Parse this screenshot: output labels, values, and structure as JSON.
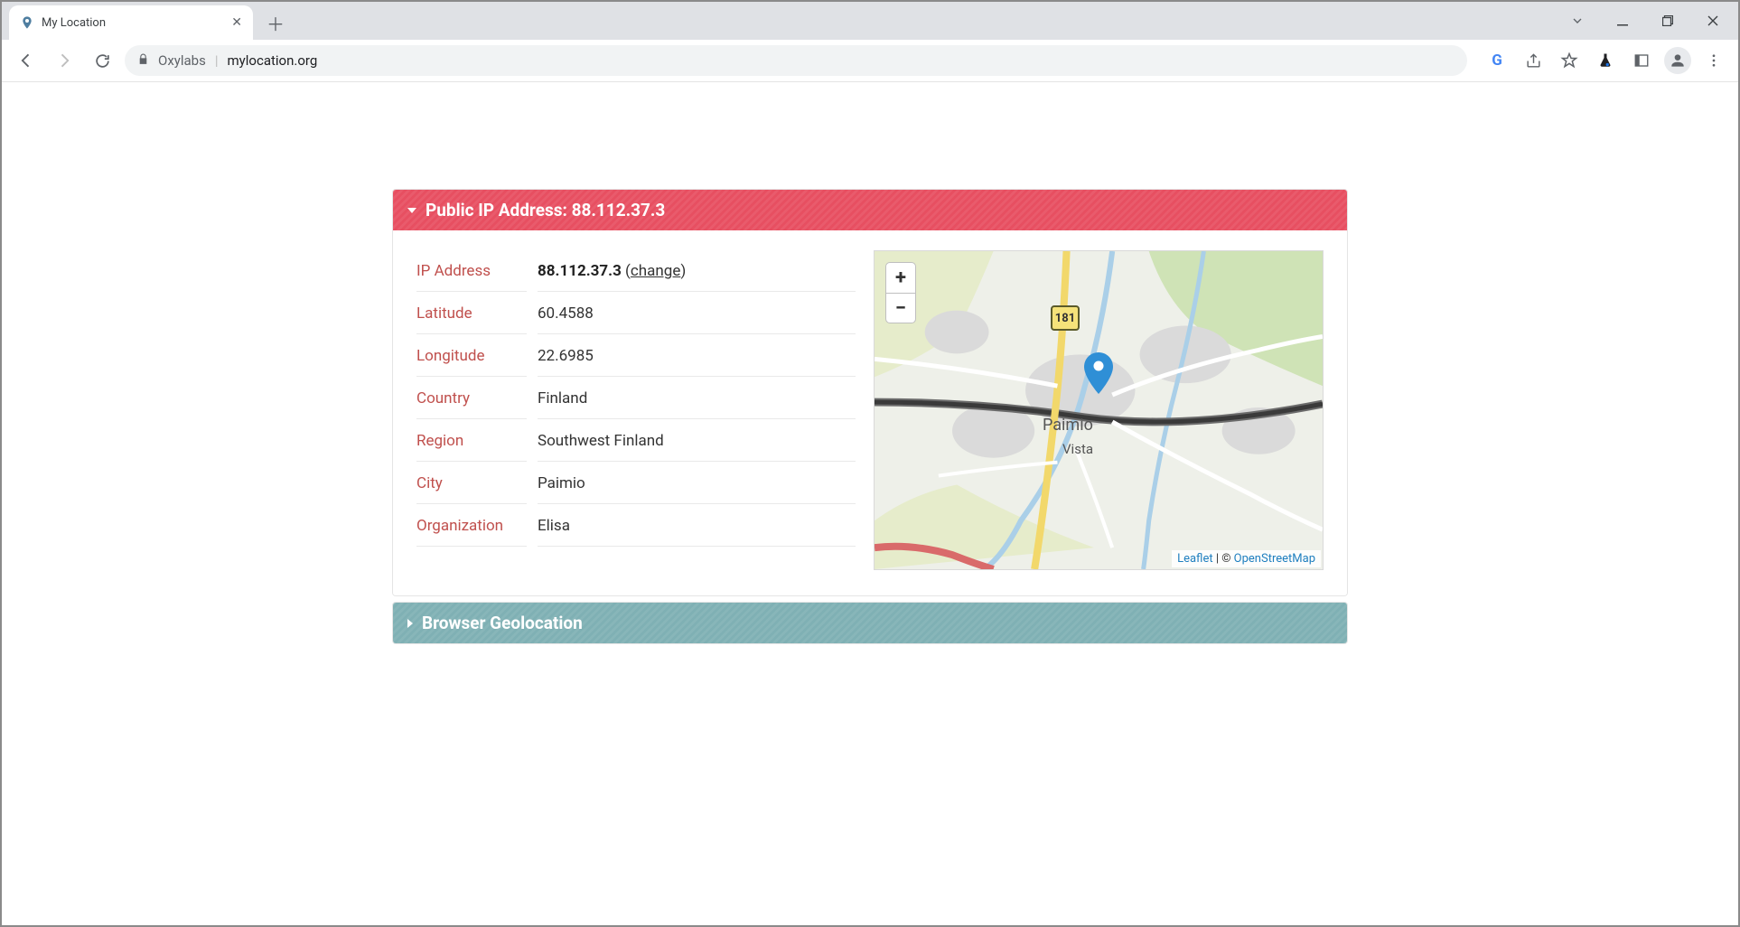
{
  "browser": {
    "tab_title": "My Location",
    "address_brand": "Oxylabs",
    "url": "mylocation.org"
  },
  "panel_ip": {
    "header_prefix": "Public IP Address: ",
    "header_ip": "88.112.37.3",
    "rows": {
      "ip_label": "IP Address",
      "ip_value": "88.112.37.3",
      "ip_change": "change",
      "lat_label": "Latitude",
      "lat_value": "60.4588",
      "lon_label": "Longitude",
      "lon_value": "22.6985",
      "country_label": "Country",
      "country_value": "Finland",
      "region_label": "Region",
      "region_value": "Southwest Finland",
      "city_label": "City",
      "city_value": "Paimio",
      "org_label": "Organization",
      "org_value": "Elisa"
    }
  },
  "panel_geo": {
    "header": "Browser Geolocation"
  },
  "map": {
    "zoom_in": "+",
    "zoom_out": "−",
    "city1": "Paimio",
    "city2": "Vista",
    "route": "181",
    "attrib_leaflet": "Leaflet",
    "attrib_sep": " | © ",
    "attrib_osm": "OpenStreetMap"
  }
}
